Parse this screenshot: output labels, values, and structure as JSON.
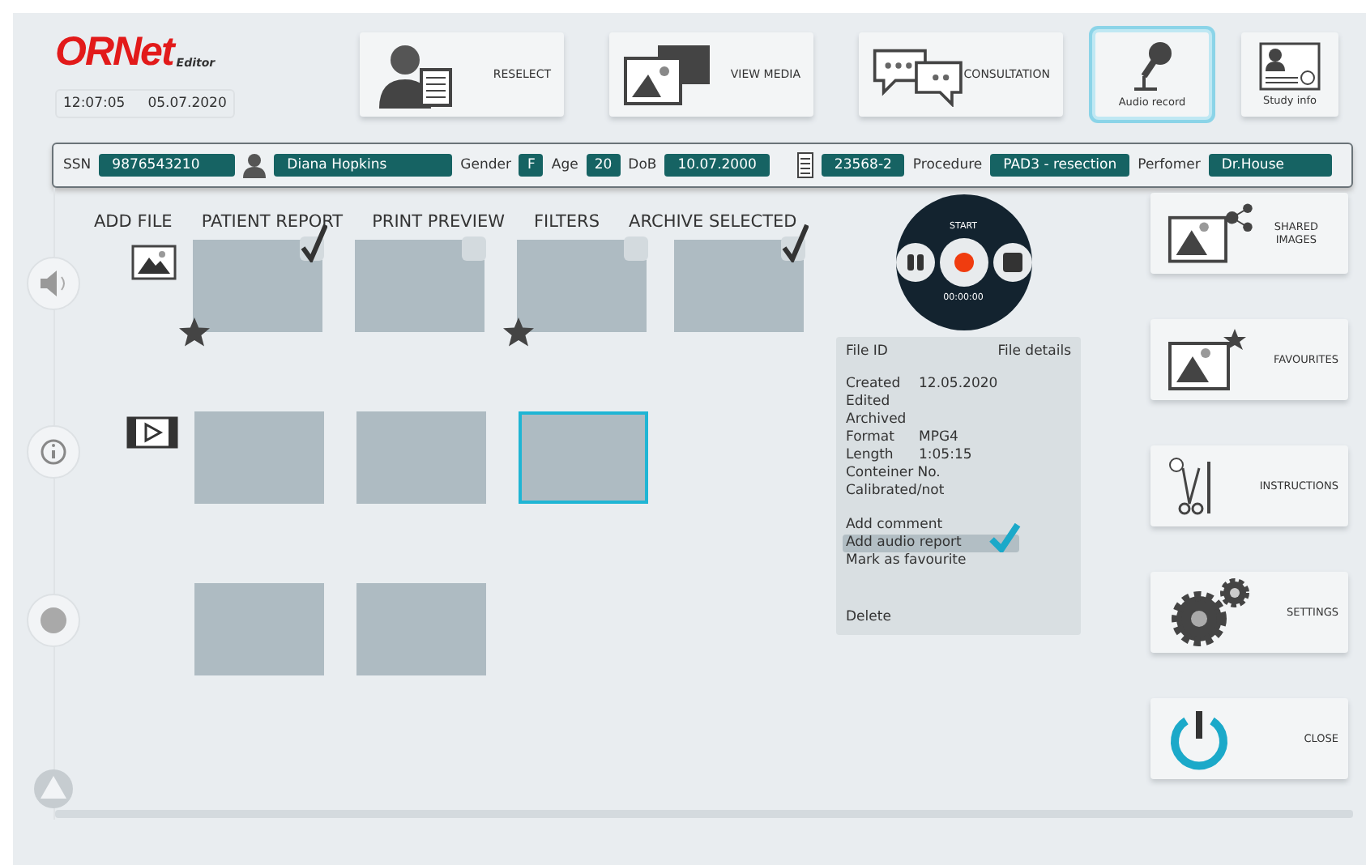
{
  "header": {
    "logo": "ORNet",
    "logo_sub": "Editor",
    "time": "12:07:05",
    "date": "05.07.2020"
  },
  "top_buttons": [
    {
      "kind": "person",
      "label": "RESELECT",
      "selected": false
    },
    {
      "kind": "media",
      "label": "VIEW MEDIA",
      "selected": false
    },
    {
      "kind": "chat",
      "label": "CONSULTATION",
      "selected": false
    },
    {
      "kind": "mic",
      "label": "Audio record",
      "selected": true
    },
    {
      "kind": "card",
      "label": "Study info",
      "selected": false
    }
  ],
  "patient_bar": [
    {
      "kind": "label",
      "label": "SSN",
      "value": "9876543210"
    },
    {
      "kind": "person",
      "value": "Diana Hopkins"
    },
    {
      "kind": "label",
      "label": "Gender",
      "value": "F"
    },
    {
      "kind": "label",
      "label": "Age",
      "value": "20"
    },
    {
      "kind": "label",
      "label": "DoB",
      "value": "10.07.2000"
    },
    {
      "kind": "document",
      "value": "23568-2"
    },
    {
      "kind": "label",
      "label": "Procedure",
      "value": "PAD3 - resection"
    },
    {
      "kind": "label",
      "label": "Perfomer",
      "value": "Dr.House"
    }
  ],
  "toolbar": [
    "ADD FILE",
    "PATIENT REPORT",
    "PRINT PREVIEW",
    "FILTERS",
    "ARCHIVE SELECTED"
  ],
  "side_rail": [
    {
      "kind": "speaker"
    },
    {
      "kind": "info"
    },
    {
      "kind": "dot"
    },
    {
      "kind": "triangle"
    }
  ],
  "media_rows": [
    {
      "kind": "image",
      "items": [
        {
          "checked": true,
          "favourite": true,
          "selected": false
        },
        {
          "checked": false,
          "favourite": false,
          "selected": false
        },
        {
          "checked": false,
          "favourite": true,
          "selected": false
        },
        {
          "checked": true,
          "favourite": false,
          "selected": false
        }
      ]
    },
    {
      "kind": "video",
      "items": [
        {
          "favourite": false,
          "selected": false
        },
        {
          "favourite": false,
          "selected": false
        },
        {
          "favourite": false,
          "selected": true
        }
      ]
    },
    {
      "kind": "none",
      "items": [
        {
          "favourite": false,
          "selected": false
        },
        {
          "favourite": false,
          "selected": false
        }
      ]
    }
  ],
  "recorder": {
    "label": "START",
    "time": "00:00:00"
  },
  "file_details": {
    "id_label": "File ID",
    "details_label": "File details",
    "properties": [
      {
        "label": "Created",
        "value": "12.05.2020"
      },
      {
        "label": "Edited"
      },
      {
        "label": "Archived"
      },
      {
        "label": "Format",
        "value": "MPG4"
      },
      {
        "label": "Length",
        "value": "1:05:15"
      },
      {
        "label": "Conteiner No."
      },
      {
        "label": "Calibrated/not"
      }
    ],
    "actions": [
      {
        "label": "Add comment",
        "selected": false
      },
      {
        "label": "Add audio report",
        "selected": true
      },
      {
        "label": "Mark as favourite",
        "selected": false
      }
    ],
    "delete": "Delete"
  },
  "side_buttons": [
    {
      "kind": "share",
      "label": "SHARED IMAGES"
    },
    {
      "kind": "favourite",
      "label": "FAVOURITES"
    },
    {
      "kind": "instruments",
      "label": "INSTRUCTIONS"
    },
    {
      "kind": "gears",
      "label": "SETTINGS"
    },
    {
      "kind": "power",
      "label": "CLOSE"
    }
  ]
}
